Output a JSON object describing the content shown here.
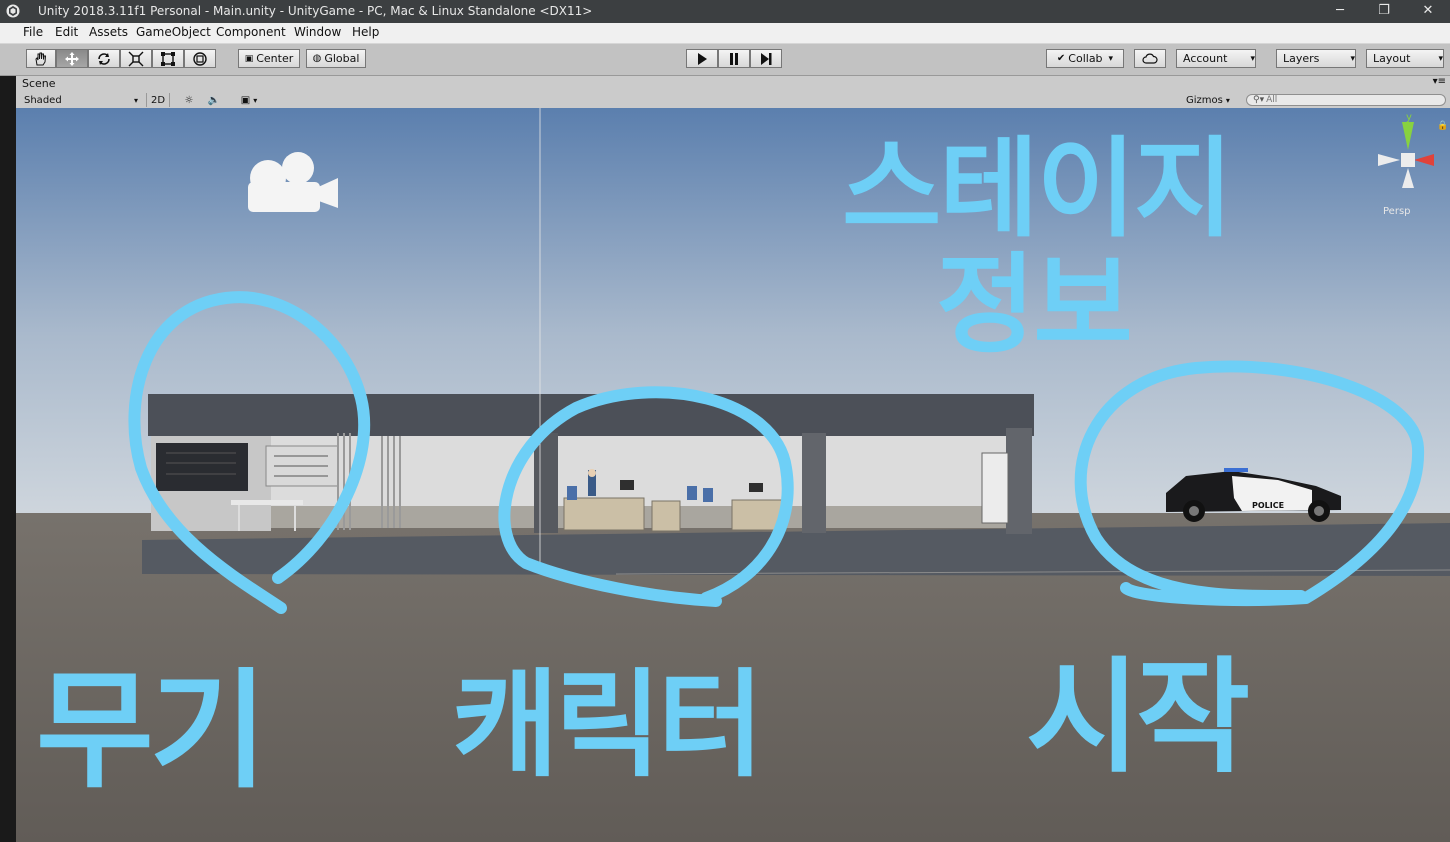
{
  "window": {
    "title": "Unity 2018.3.11f1 Personal - Main.unity - UnityGame - PC, Mac & Linux Standalone <DX11>"
  },
  "menu": [
    "File",
    "Edit",
    "Assets",
    "GameObject",
    "Component",
    "Window",
    "Help"
  ],
  "toolbar": {
    "pivot_label": "Center",
    "space_label": "Global",
    "collab_label": "Collab",
    "account_label": "Account",
    "layers_label": "Layers",
    "layout_label": "Layout"
  },
  "scene": {
    "tab_label": "Scene",
    "shading_mode": "Shaded",
    "mode_2d_label": "2D",
    "gizmos_label": "Gizmos",
    "search_placeholder": "All",
    "projection_label": "Persp",
    "gizmo_axis_y": "y",
    "police_text": "POLICE"
  },
  "annotations": {
    "weapons": "무기",
    "character": "캐릭터",
    "stage_info_line1": "스테이지",
    "stage_info_line2": "정보",
    "start": "시작",
    "color": "#6ecff6"
  },
  "colors": {
    "sky_top": "#5b7fae",
    "sky_bottom": "#cfd6dd",
    "ground": "#6b6661"
  }
}
